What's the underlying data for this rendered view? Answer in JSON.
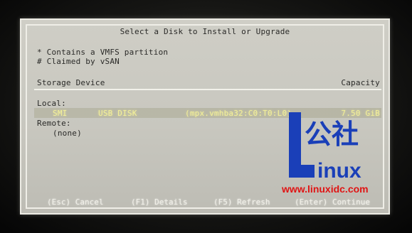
{
  "dialog": {
    "title": "Select a Disk to Install or Upgrade",
    "legend": [
      "* Contains a VMFS partition",
      "# Claimed by vSAN"
    ]
  },
  "table": {
    "headers": {
      "device": "Storage Device",
      "capacity": "Capacity"
    },
    "groups": {
      "local": "Local:",
      "remote": "Remote:"
    },
    "local_rows": [
      {
        "vendor": "SMI",
        "model": "USB DISK",
        "path": "(mpx.vmhba32:C0:T0:L0)",
        "capacity": "7.50 GiB",
        "selected": true
      }
    ],
    "remote_empty": "(none)"
  },
  "footer": {
    "cancel": "(Esc) Cancel",
    "details": "(F1) Details",
    "refresh": "(F5) Refresh",
    "continue": "(Enter) Continue"
  },
  "watermark": {
    "chars": "公社",
    "word": "inux",
    "url": "www.linuxidc.com"
  },
  "colors": {
    "dialog_bg": "#c9c8c0",
    "text": "#2a2a28",
    "highlight_text": "#f3f098",
    "footer_text": "#f1f0e8",
    "watermark_blue": "#1a3fb8",
    "watermark_red": "#e01414"
  }
}
